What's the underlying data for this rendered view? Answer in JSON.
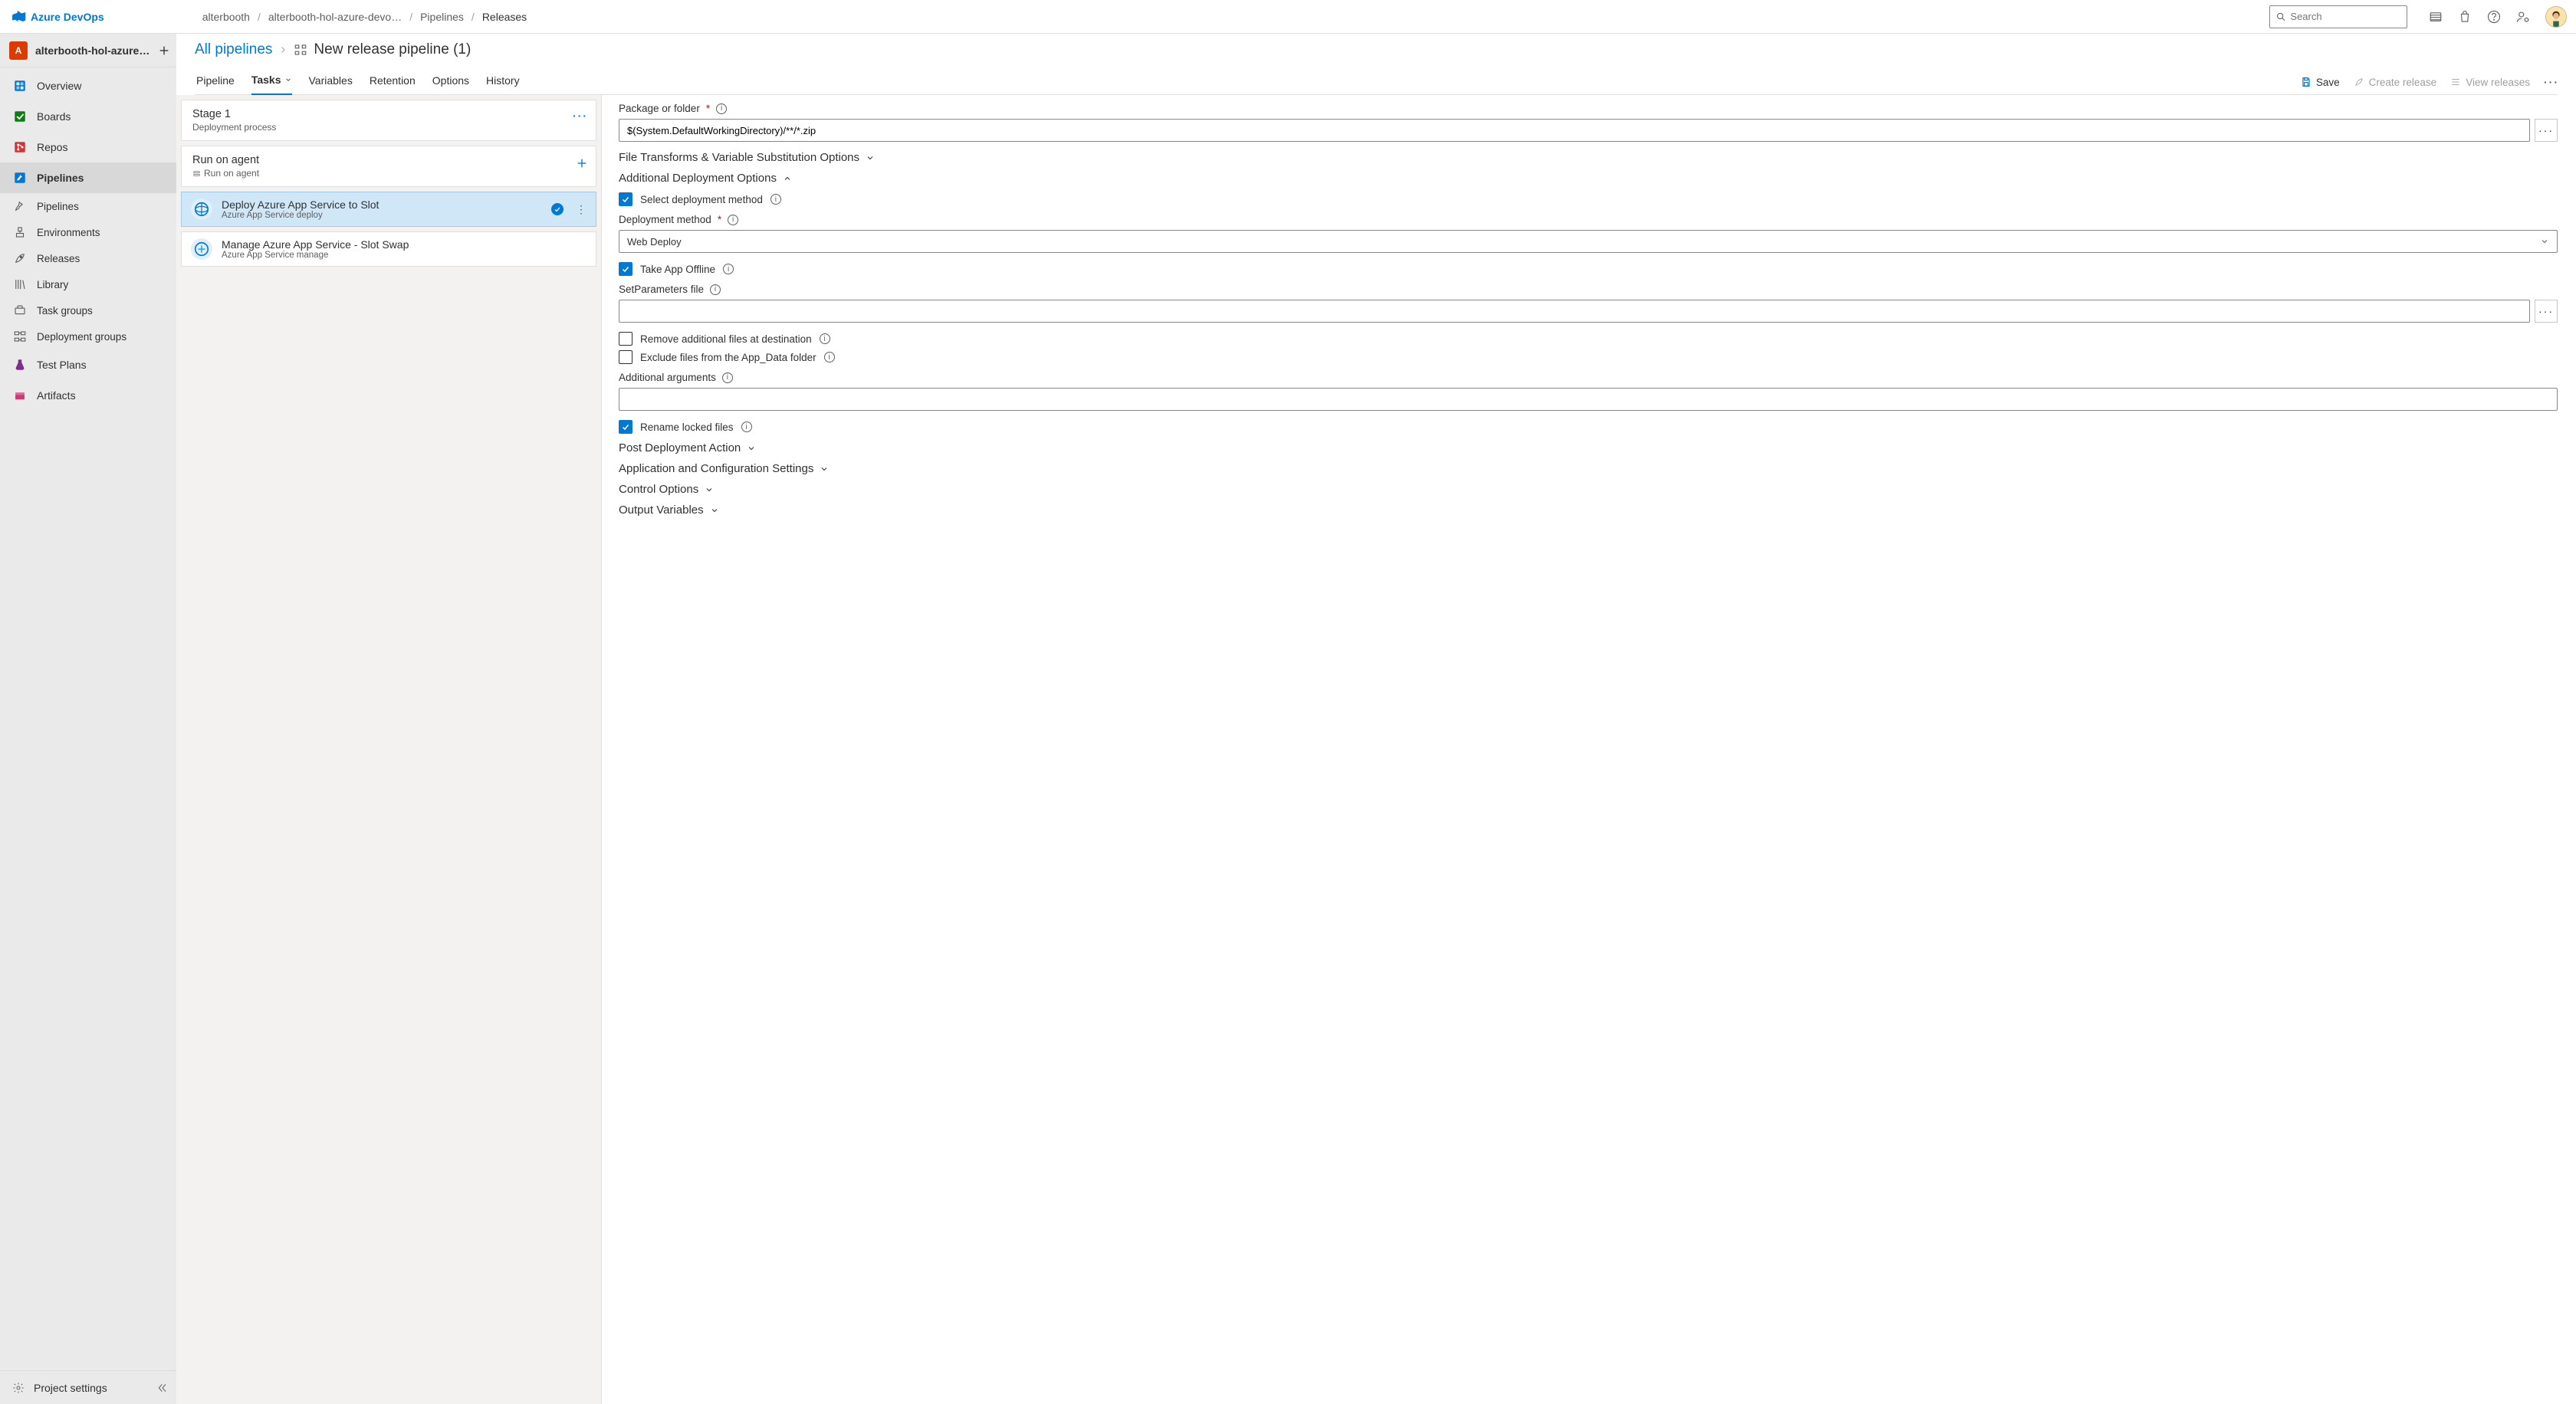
{
  "brand": {
    "name": "Azure DevOps"
  },
  "breadcrumb": {
    "items": [
      "alterbooth",
      "alterbooth-hol-azure-devo…",
      "Pipelines",
      "Releases"
    ]
  },
  "search": {
    "placeholder": "Search"
  },
  "sidebar": {
    "project_letter": "A",
    "project_name": "alterbooth-hol-azure…",
    "items": [
      {
        "label": "Overview",
        "icon": "overview"
      },
      {
        "label": "Boards",
        "icon": "boards"
      },
      {
        "label": "Repos",
        "icon": "repos"
      },
      {
        "label": "Pipelines",
        "icon": "pipelines",
        "active": true,
        "sub": [
          {
            "label": "Pipelines",
            "icon": "pipelines-sub"
          },
          {
            "label": "Environments",
            "icon": "environments"
          },
          {
            "label": "Releases",
            "icon": "releases"
          },
          {
            "label": "Library",
            "icon": "library"
          },
          {
            "label": "Task groups",
            "icon": "taskgroups"
          },
          {
            "label": "Deployment groups",
            "icon": "deploygroups"
          }
        ]
      },
      {
        "label": "Test Plans",
        "icon": "testplans"
      },
      {
        "label": "Artifacts",
        "icon": "artifacts"
      }
    ],
    "settings_label": "Project settings"
  },
  "page": {
    "all_pipelines_label": "All pipelines",
    "pipeline_name": "New release pipeline (1)",
    "actions": {
      "save": "Save",
      "create_release": "Create release",
      "view_releases": "View releases"
    },
    "tabs": [
      "Pipeline",
      "Tasks",
      "Variables",
      "Retention",
      "Options",
      "History"
    ],
    "active_tab_index": 1
  },
  "tasks_pane": {
    "stage": {
      "title": "Stage 1",
      "sub": "Deployment process"
    },
    "agent": {
      "title": "Run on agent",
      "sub": "Run on agent"
    },
    "tasks": [
      {
        "title": "Deploy Azure App Service to Slot",
        "sub": "Azure App Service deploy",
        "selected": true,
        "status": "ok"
      },
      {
        "title": "Manage Azure App Service - Slot Swap",
        "sub": "Azure App Service manage",
        "selected": false
      }
    ]
  },
  "form": {
    "package_label": "Package or folder",
    "package_value": "$(System.DefaultWorkingDirectory)/**/*.zip",
    "file_transforms_header": "File Transforms & Variable Substitution Options",
    "additional_deploy_header": "Additional Deployment Options",
    "select_deploy_method_label": "Select deployment method",
    "select_deploy_method_checked": true,
    "deployment_method_label": "Deployment method",
    "deployment_method_value": "Web Deploy",
    "take_app_offline_label": "Take App Offline",
    "take_app_offline_checked": true,
    "setparams_label": "SetParameters file",
    "setparams_value": "",
    "remove_additional_label": "Remove additional files at destination",
    "remove_additional_checked": false,
    "exclude_appdata_label": "Exclude files from the App_Data folder",
    "exclude_appdata_checked": false,
    "additional_args_label": "Additional arguments",
    "additional_args_value": "",
    "rename_locked_label": "Rename locked files",
    "rename_locked_checked": true,
    "sections": {
      "post_deploy": "Post Deployment Action",
      "app_config": "Application and Configuration Settings",
      "control_options": "Control Options",
      "output_vars": "Output Variables"
    }
  }
}
